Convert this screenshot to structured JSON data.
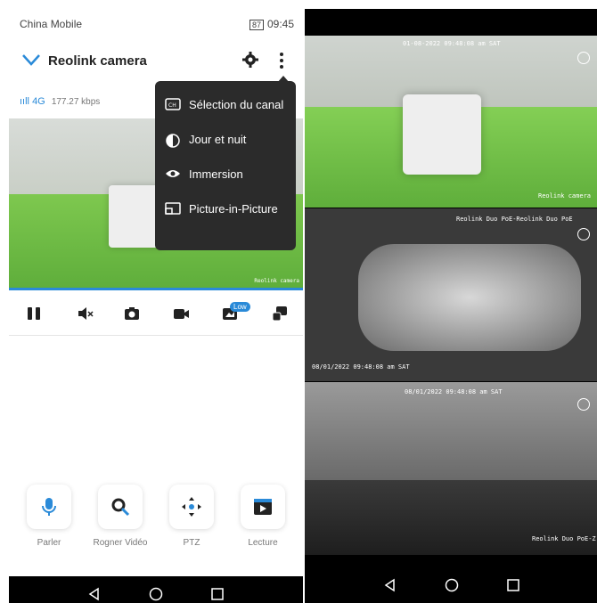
{
  "left_phone": {
    "status": {
      "carrier": "China Mobile",
      "time": "09:45",
      "battery": "87"
    },
    "header": {
      "title": "Reolink camera"
    },
    "network": {
      "type": "4G",
      "rate": "177.27 kbps"
    },
    "feed": {
      "label": "Reolink camera"
    },
    "controls": {
      "low_badge": "Low"
    },
    "menu": {
      "items": [
        {
          "label": "Sélection du canal",
          "icon": "channel-icon"
        },
        {
          "label": "Jour et nuit",
          "icon": "day-night-icon"
        },
        {
          "label": "Immersion",
          "icon": "eye-icon"
        },
        {
          "label": "Picture-in-Picture",
          "icon": "pip-icon"
        }
      ]
    },
    "bottom_actions": [
      {
        "label": "Parler",
        "icon": "mic-icon"
      },
      {
        "label": "Rogner Vidéo",
        "icon": "zoom-icon"
      },
      {
        "label": "PTZ",
        "icon": "ptz-icon"
      },
      {
        "label": "Lecture",
        "icon": "play-icon"
      }
    ]
  },
  "right_phone": {
    "cam1": {
      "timestamp": "01-08-2022 09:48:08 am SAT",
      "label": "Reolink camera"
    },
    "cam2": {
      "label": "Reolink Duo PoE-Reolink Duo PoE",
      "timestamp": "08/01/2022 09:48:08 am SAT"
    },
    "cam3": {
      "timestamp": "08/01/2022 09:48:08 am SAT",
      "label": "Reolink Duo PoE-Z"
    }
  },
  "colors": {
    "accent": "#2a8ad8",
    "menu_bg": "#2b2b2b",
    "navbar": "#000000"
  }
}
